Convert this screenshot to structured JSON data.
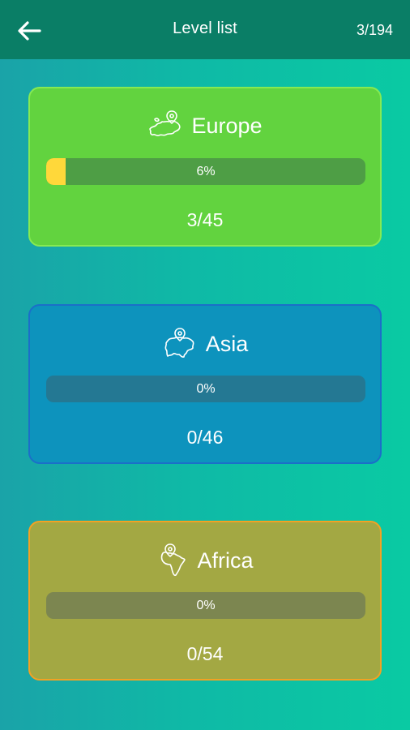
{
  "header": {
    "title": "Level list",
    "progress": "3/194",
    "back_icon": "arrow-left-icon"
  },
  "levels": [
    {
      "name": "Europe",
      "icon": "europe-map-pin-icon",
      "percent_label": "6%",
      "fraction": 0.06,
      "count": "3/45",
      "bg_color": "#62d33f",
      "border_color": "#86ea52",
      "track_color": "#4e9e45"
    },
    {
      "name": "Asia",
      "icon": "asia-map-pin-icon",
      "percent_label": "0%",
      "fraction": 0,
      "count": "0/46",
      "bg_color": "#0d93bd",
      "border_color": "#1b6fc9",
      "track_color": "#247893"
    },
    {
      "name": "Africa",
      "icon": "africa-map-pin-icon",
      "percent_label": "0%",
      "fraction": 0,
      "count": "0/54",
      "bg_color": "#a3a843",
      "border_color": "#f2a223",
      "track_color": "#7c8650"
    }
  ]
}
